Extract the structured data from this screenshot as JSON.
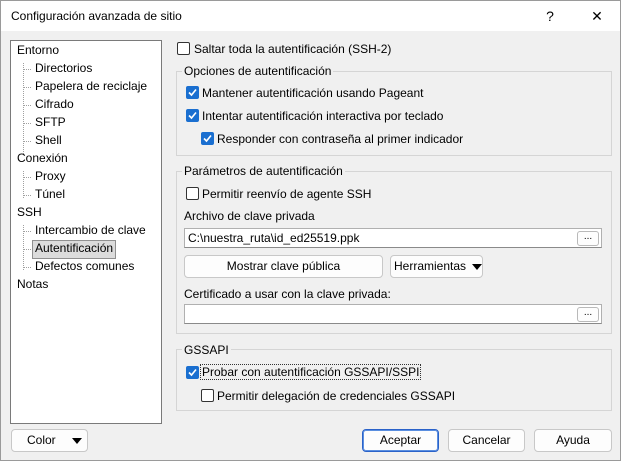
{
  "window": {
    "title": "Configuración avanzada de sitio",
    "help_glyph": "?",
    "close_glyph": "✕"
  },
  "tree": {
    "items": [
      {
        "label": "Entorno",
        "level": 0
      },
      {
        "label": "Directorios",
        "level": 1
      },
      {
        "label": "Papelera de reciclaje",
        "level": 1
      },
      {
        "label": "Cifrado",
        "level": 1
      },
      {
        "label": "SFTP",
        "level": 1
      },
      {
        "label": "Shell",
        "level": 1
      },
      {
        "label": "Conexión",
        "level": 0
      },
      {
        "label": "Proxy",
        "level": 1
      },
      {
        "label": "Túnel",
        "level": 1
      },
      {
        "label": "SSH",
        "level": 0
      },
      {
        "label": "Intercambio de clave",
        "level": 1
      },
      {
        "label": "Autentificación",
        "level": 1,
        "selected": true
      },
      {
        "label": "Defectos comunes",
        "level": 1
      },
      {
        "label": "Notas",
        "level": 0
      }
    ]
  },
  "skip_auth": {
    "label": "Saltar toda la autentificación (SSH-2)",
    "checked": false
  },
  "auth_options": {
    "title": "Opciones de autentificación",
    "pageant": {
      "label": "Mantener autentificación usando Pageant",
      "checked": true
    },
    "keyboard_interactive": {
      "label": "Intentar autentificación interactiva por teclado",
      "checked": true
    },
    "password_first": {
      "label": "Responder con contraseña al primer indicador",
      "checked": true
    }
  },
  "auth_params": {
    "title": "Parámetros de autentificación",
    "agent_forwarding": {
      "label": "Permitir reenvío de agente SSH",
      "checked": false
    },
    "private_key_label": "Archivo de clave privada",
    "private_key_value": "C:\\nuestra_ruta\\id_ed25519.ppk",
    "browse_label": "...",
    "show_public_key": "Mostrar clave pública",
    "tools": "Herramientas",
    "certificate_label": "Certificado a usar con la clave privada:",
    "certificate_value": "",
    "browse_label2": "..."
  },
  "gssapi": {
    "title": "GSSAPI",
    "try_gssapi": {
      "label": "Probar con autentificación GSSAPI/SSPI",
      "checked": true
    },
    "delegation": {
      "label": "Permitir delegación de credenciales GSSAPI",
      "checked": false
    }
  },
  "footer": {
    "color": "Color",
    "accept": "Aceptar",
    "cancel": "Cancelar",
    "help": "Ayuda"
  },
  "colors": {
    "accent": "#1a6fd0",
    "window_bg": "#f0f0f0"
  }
}
